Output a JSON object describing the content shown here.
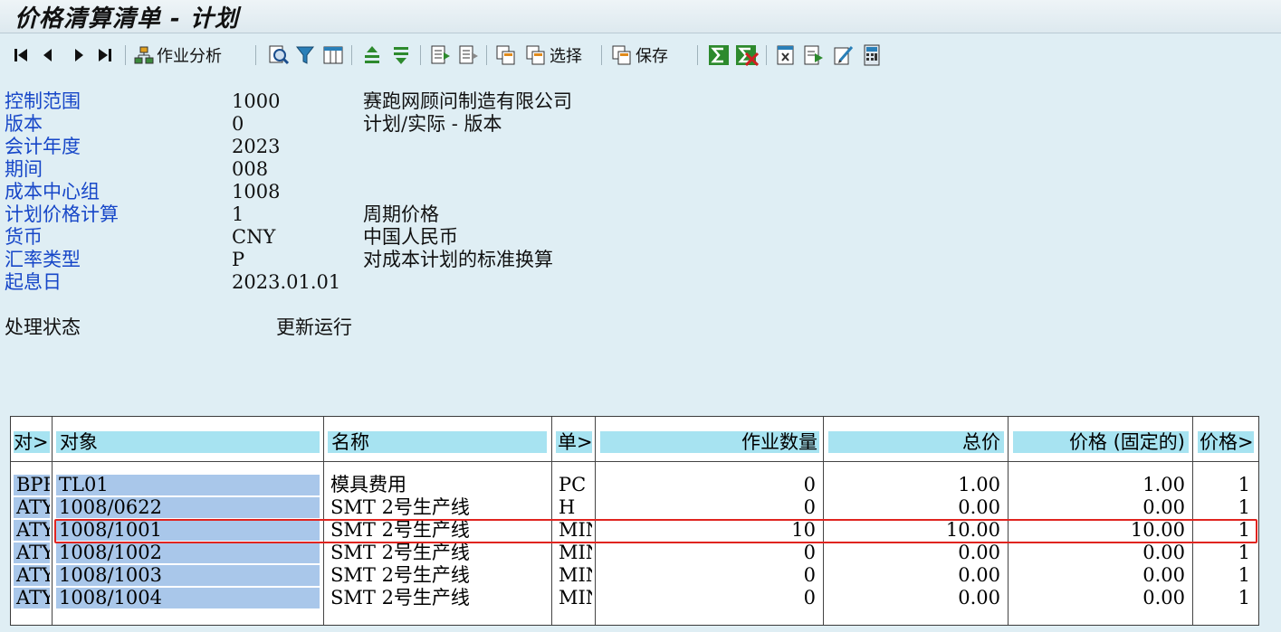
{
  "window": {
    "title": "价格清算清单 - 计划"
  },
  "toolbar": {
    "activity_analysis": "作业分析",
    "select": "选择",
    "save": "保存"
  },
  "header": {
    "controlling_area": {
      "label": "控制范围",
      "value": "1000",
      "desc": "赛跑网顾问制造有限公司"
    },
    "version": {
      "label": "版本",
      "value": "0",
      "desc": "计划/实际 - 版本"
    },
    "fiscal_year": {
      "label": "会计年度",
      "value": "2023"
    },
    "period": {
      "label": "期间",
      "value": "008"
    },
    "cost_center_group": {
      "label": "成本中心组",
      "value": "1008"
    },
    "plan_price_calc": {
      "label": "计划价格计算",
      "value": "1",
      "desc": "周期价格"
    },
    "currency": {
      "label": "货币",
      "value": "CNY",
      "desc": "中国人民币"
    },
    "exchange_rate_type": {
      "label": "汇率类型",
      "value": "P",
      "desc": "对成本计划的标准换算"
    },
    "start_date": {
      "label": "起息日",
      "value": "2023.01.01"
    },
    "processing_status": {
      "label": "处理状态",
      "value": "更新运行"
    }
  },
  "table": {
    "columns": [
      "对>",
      "对象",
      "名称",
      "单>",
      "作业数量",
      "总价",
      "价格 (固定的)",
      "价格>"
    ],
    "rows": [
      [
        "BPR",
        "TL01",
        "模具费用",
        "PC",
        "0",
        "1.00",
        "1.00",
        "1"
      ],
      [
        "ATY",
        "1008/0622",
        "SMT 2号生产线",
        "H",
        "0",
        "0.00",
        "0.00",
        "1"
      ],
      [
        "ATY",
        "1008/1001",
        "SMT 2号生产线",
        "MIN",
        "10",
        "10.00",
        "10.00",
        "1"
      ],
      [
        "ATY",
        "1008/1002",
        "SMT 2号生产线",
        "MIN",
        "0",
        "0.00",
        "0.00",
        "1"
      ],
      [
        "ATY",
        "1008/1003",
        "SMT 2号生产线",
        "MIN",
        "0",
        "0.00",
        "0.00",
        "1"
      ],
      [
        "ATY",
        "1008/1004",
        "SMT 2号生产线",
        "MIN",
        "0",
        "0.00",
        "0.00",
        "1"
      ]
    ],
    "highlighted_row": 2
  },
  "colors": {
    "highlight_border": "#e0241f",
    "column_header": "#a7e3f1",
    "key_cell": "#a9c7ea",
    "label_text": "#1747c8"
  }
}
